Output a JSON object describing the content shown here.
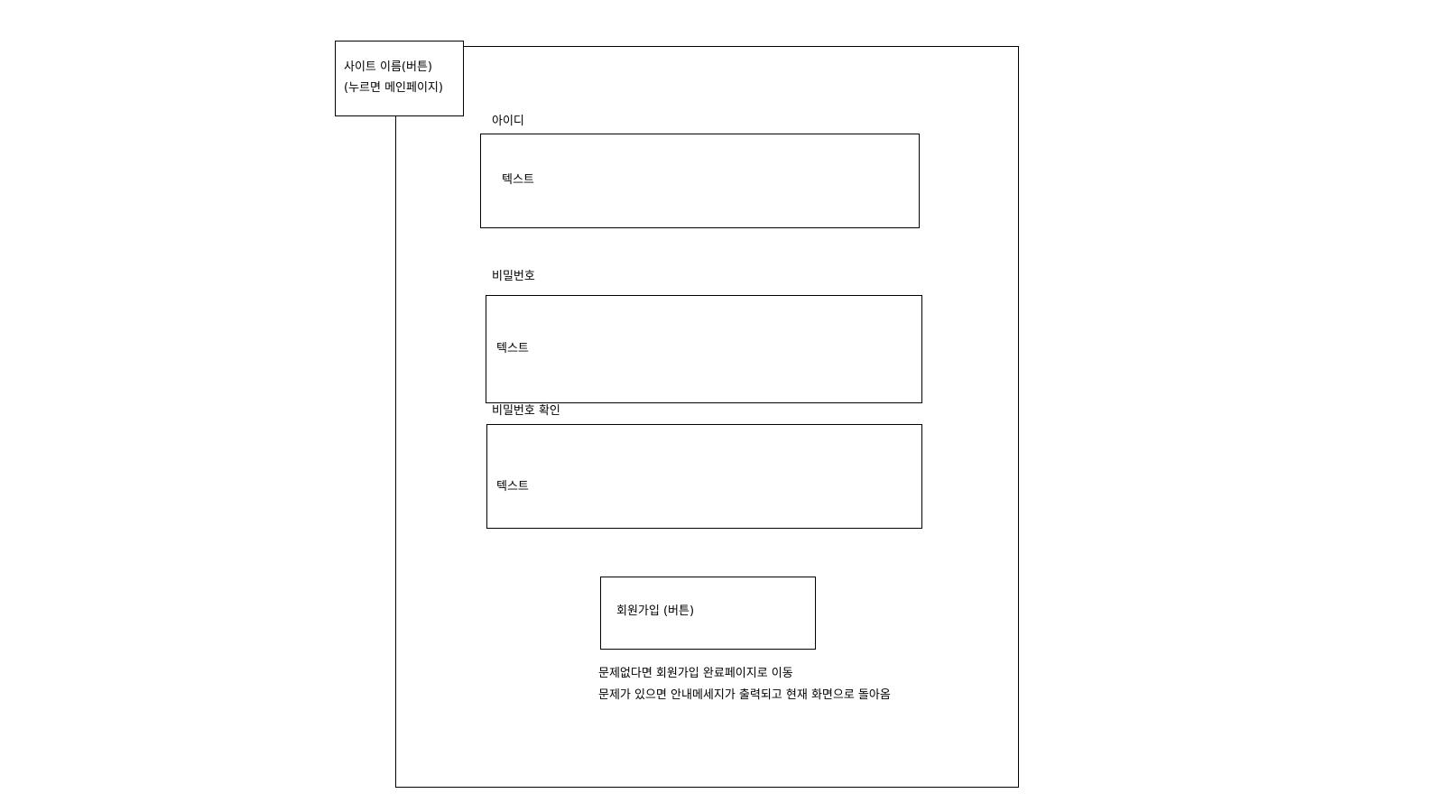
{
  "site_button": {
    "line1": "사이트 이름(버튼)",
    "line2": "(누르면 메인페이지)"
  },
  "fields": [
    {
      "label": "아이디",
      "placeholder": "텍스트"
    },
    {
      "label": "비밀번호",
      "placeholder": "텍스트"
    },
    {
      "label": "비밀번호 확인",
      "placeholder": "텍스트"
    }
  ],
  "signup_button": {
    "label": "회원가입 (버튼)"
  },
  "notes": {
    "success": "문제없다면 회원가입 완료페이지로 이동",
    "failure": "문제가 있으면 안내메세지가 출력되고 현재 화면으로 돌아옴"
  }
}
